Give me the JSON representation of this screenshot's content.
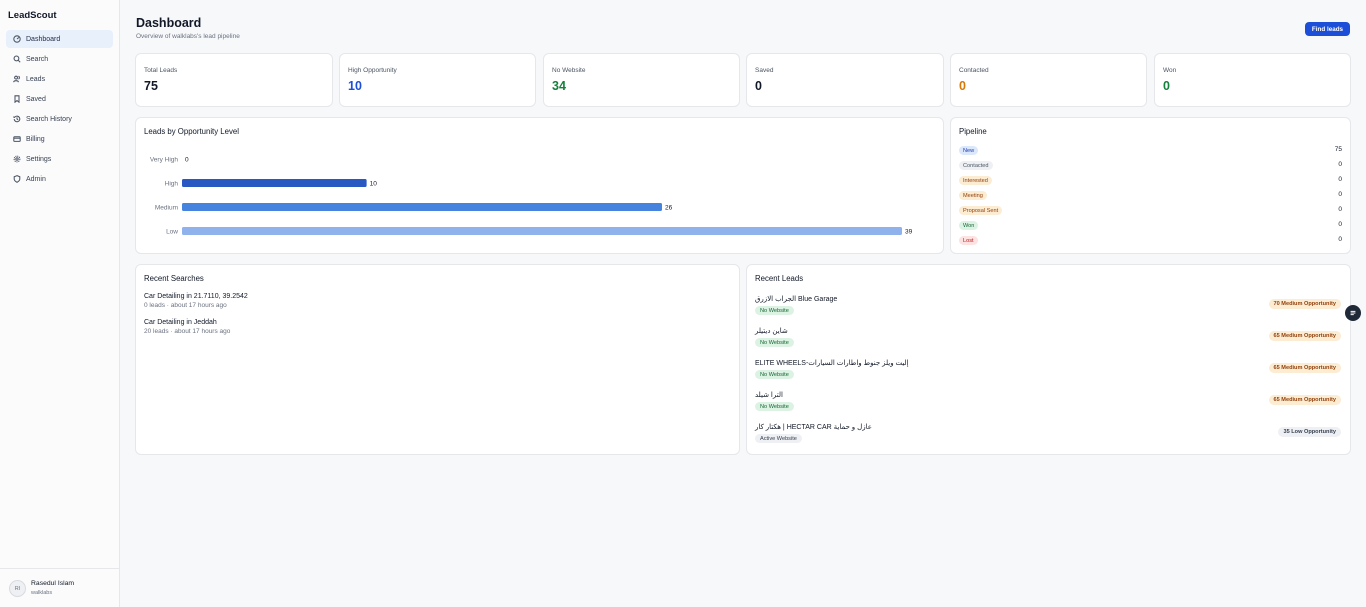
{
  "app": {
    "name": "LeadScout"
  },
  "sidebar": {
    "items": [
      {
        "label": "Dashboard",
        "icon": "dashboard-icon",
        "active": true
      },
      {
        "label": "Search",
        "icon": "search-icon"
      },
      {
        "label": "Leads",
        "icon": "users-icon"
      },
      {
        "label": "Saved",
        "icon": "bookmark-icon"
      },
      {
        "label": "Search History",
        "icon": "history-icon"
      },
      {
        "label": "Billing",
        "icon": "credit-card-icon"
      },
      {
        "label": "Settings",
        "icon": "gear-icon"
      },
      {
        "label": "Admin",
        "icon": "shield-icon"
      }
    ]
  },
  "user": {
    "initials": "RI",
    "name": "Rasedul Islam",
    "org": "walklabs"
  },
  "header": {
    "title": "Dashboard",
    "subtitle": "Overview of walklabs's lead pipeline",
    "find_button": "Find leads"
  },
  "stats": [
    {
      "label": "Total Leads",
      "value": "75",
      "color": "#111827"
    },
    {
      "label": "High Opportunity",
      "value": "10",
      "color": "#1d4ed8"
    },
    {
      "label": "No Website",
      "value": "34",
      "color": "#15803d"
    },
    {
      "label": "Saved",
      "value": "0",
      "color": "#111827"
    },
    {
      "label": "Contacted",
      "value": "0",
      "color": "#d97706"
    },
    {
      "label": "Won",
      "value": "0",
      "color": "#15803d"
    }
  ],
  "opportunity_chart": {
    "title": "Leads by Opportunity Level"
  },
  "chart_data": {
    "type": "bar",
    "orientation": "horizontal",
    "title": "Leads by Opportunity Level",
    "categories": [
      "Very High",
      "High",
      "Medium",
      "Low"
    ],
    "values": [
      0,
      10,
      26,
      39
    ],
    "colors": [
      "#1e40af",
      "#2859c2",
      "#4683df",
      "#8fb2ec"
    ],
    "xlim": [
      0,
      39
    ],
    "grid": false,
    "legend": "none"
  },
  "pipeline": {
    "title": "Pipeline",
    "rows": [
      {
        "label": "New",
        "count": "75",
        "bg": "#dbe7fb",
        "fg": "#1e40af"
      },
      {
        "label": "Contacted",
        "count": "0",
        "bg": "#eef0f3",
        "fg": "#4b5563"
      },
      {
        "label": "Interested",
        "count": "0",
        "bg": "#fbecd2",
        "fg": "#92400e"
      },
      {
        "label": "Meeting",
        "count": "0",
        "bg": "#fbecd2",
        "fg": "#92400e"
      },
      {
        "label": "Proposal Sent",
        "count": "0",
        "bg": "#fbecd2",
        "fg": "#92400e"
      },
      {
        "label": "Won",
        "count": "0",
        "bg": "#dcf3e4",
        "fg": "#166534"
      },
      {
        "label": "Lost",
        "count": "0",
        "bg": "#fde2e2",
        "fg": "#b91c1c"
      }
    ]
  },
  "recent_searches": {
    "title": "Recent Searches",
    "items": [
      {
        "title": "Car Detailing in 21.7110, 39.2542",
        "meta": "0 leads · about 17 hours ago"
      },
      {
        "title": "Car Detailing in Jeddah",
        "meta": "20 leads · about 17 hours ago"
      }
    ]
  },
  "recent_leads": {
    "title": "Recent Leads",
    "items": [
      {
        "name": "الجراب الازرق Blue Garage",
        "badge": "No Website",
        "badge_bg": "#dcf3e4",
        "badge_fg": "#166534",
        "opportunity": "70 Medium Opportunity",
        "opp_bg": "#fbecd2",
        "opp_fg": "#92400e"
      },
      {
        "name": "شاين ديتيلر",
        "badge": "No Website",
        "badge_bg": "#dcf3e4",
        "badge_fg": "#166534",
        "opportunity": "65 Medium Opportunity",
        "opp_bg": "#fbecd2",
        "opp_fg": "#92400e"
      },
      {
        "name": "ELITE WHEELS-إليت ويلز جنوط واطارات السيارات",
        "badge": "No Website",
        "badge_bg": "#dcf3e4",
        "badge_fg": "#166534",
        "opportunity": "65 Medium Opportunity",
        "opp_bg": "#fbecd2",
        "opp_fg": "#92400e"
      },
      {
        "name": "الترا شيلد",
        "badge": "No Website",
        "badge_bg": "#dcf3e4",
        "badge_fg": "#166534",
        "opportunity": "65 Medium Opportunity",
        "opp_bg": "#fbecd2",
        "opp_fg": "#92400e"
      },
      {
        "name": "هكتار كار | HECTAR CAR عازل و حماية",
        "badge": "Active Website",
        "badge_bg": "#eef0f3",
        "badge_fg": "#374151",
        "opportunity": "35 Low Opportunity",
        "opp_bg": "#eef0f3",
        "opp_fg": "#374151"
      }
    ]
  }
}
